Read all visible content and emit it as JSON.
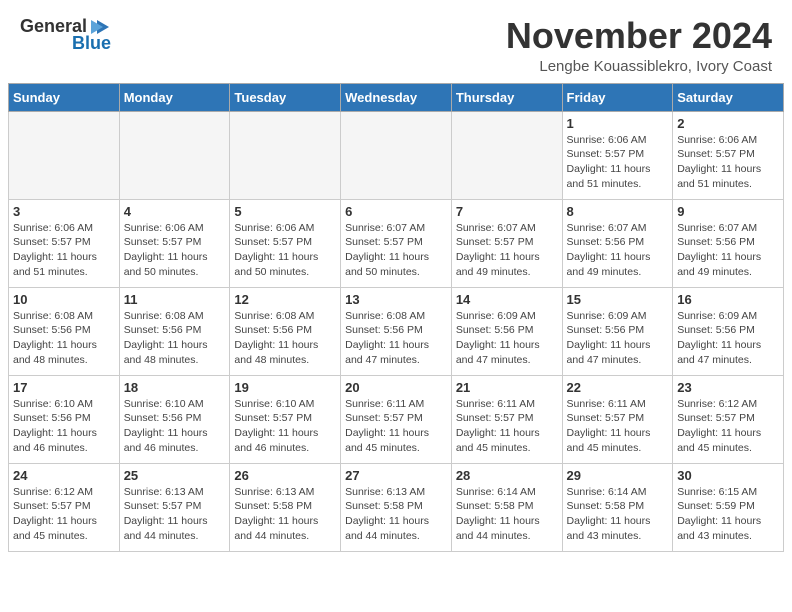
{
  "logo": {
    "general": "General",
    "blue": "Blue"
  },
  "header": {
    "month": "November 2024",
    "location": "Lengbe Kouassiblekro, Ivory Coast"
  },
  "days_of_week": [
    "Sunday",
    "Monday",
    "Tuesday",
    "Wednesday",
    "Thursday",
    "Friday",
    "Saturday"
  ],
  "weeks": [
    [
      {
        "day": "",
        "empty": true
      },
      {
        "day": "",
        "empty": true
      },
      {
        "day": "",
        "empty": true
      },
      {
        "day": "",
        "empty": true
      },
      {
        "day": "",
        "empty": true
      },
      {
        "day": "1",
        "sunrise": "6:06 AM",
        "sunset": "5:57 PM",
        "daylight": "11 hours and 51 minutes."
      },
      {
        "day": "2",
        "sunrise": "6:06 AM",
        "sunset": "5:57 PM",
        "daylight": "11 hours and 51 minutes."
      }
    ],
    [
      {
        "day": "3",
        "sunrise": "6:06 AM",
        "sunset": "5:57 PM",
        "daylight": "11 hours and 51 minutes."
      },
      {
        "day": "4",
        "sunrise": "6:06 AM",
        "sunset": "5:57 PM",
        "daylight": "11 hours and 50 minutes."
      },
      {
        "day": "5",
        "sunrise": "6:06 AM",
        "sunset": "5:57 PM",
        "daylight": "11 hours and 50 minutes."
      },
      {
        "day": "6",
        "sunrise": "6:07 AM",
        "sunset": "5:57 PM",
        "daylight": "11 hours and 50 minutes."
      },
      {
        "day": "7",
        "sunrise": "6:07 AM",
        "sunset": "5:57 PM",
        "daylight": "11 hours and 49 minutes."
      },
      {
        "day": "8",
        "sunrise": "6:07 AM",
        "sunset": "5:56 PM",
        "daylight": "11 hours and 49 minutes."
      },
      {
        "day": "9",
        "sunrise": "6:07 AM",
        "sunset": "5:56 PM",
        "daylight": "11 hours and 49 minutes."
      }
    ],
    [
      {
        "day": "10",
        "sunrise": "6:08 AM",
        "sunset": "5:56 PM",
        "daylight": "11 hours and 48 minutes."
      },
      {
        "day": "11",
        "sunrise": "6:08 AM",
        "sunset": "5:56 PM",
        "daylight": "11 hours and 48 minutes."
      },
      {
        "day": "12",
        "sunrise": "6:08 AM",
        "sunset": "5:56 PM",
        "daylight": "11 hours and 48 minutes."
      },
      {
        "day": "13",
        "sunrise": "6:08 AM",
        "sunset": "5:56 PM",
        "daylight": "11 hours and 47 minutes."
      },
      {
        "day": "14",
        "sunrise": "6:09 AM",
        "sunset": "5:56 PM",
        "daylight": "11 hours and 47 minutes."
      },
      {
        "day": "15",
        "sunrise": "6:09 AM",
        "sunset": "5:56 PM",
        "daylight": "11 hours and 47 minutes."
      },
      {
        "day": "16",
        "sunrise": "6:09 AM",
        "sunset": "5:56 PM",
        "daylight": "11 hours and 47 minutes."
      }
    ],
    [
      {
        "day": "17",
        "sunrise": "6:10 AM",
        "sunset": "5:56 PM",
        "daylight": "11 hours and 46 minutes."
      },
      {
        "day": "18",
        "sunrise": "6:10 AM",
        "sunset": "5:56 PM",
        "daylight": "11 hours and 46 minutes."
      },
      {
        "day": "19",
        "sunrise": "6:10 AM",
        "sunset": "5:57 PM",
        "daylight": "11 hours and 46 minutes."
      },
      {
        "day": "20",
        "sunrise": "6:11 AM",
        "sunset": "5:57 PM",
        "daylight": "11 hours and 45 minutes."
      },
      {
        "day": "21",
        "sunrise": "6:11 AM",
        "sunset": "5:57 PM",
        "daylight": "11 hours and 45 minutes."
      },
      {
        "day": "22",
        "sunrise": "6:11 AM",
        "sunset": "5:57 PM",
        "daylight": "11 hours and 45 minutes."
      },
      {
        "day": "23",
        "sunrise": "6:12 AM",
        "sunset": "5:57 PM",
        "daylight": "11 hours and 45 minutes."
      }
    ],
    [
      {
        "day": "24",
        "sunrise": "6:12 AM",
        "sunset": "5:57 PM",
        "daylight": "11 hours and 45 minutes."
      },
      {
        "day": "25",
        "sunrise": "6:13 AM",
        "sunset": "5:57 PM",
        "daylight": "11 hours and 44 minutes."
      },
      {
        "day": "26",
        "sunrise": "6:13 AM",
        "sunset": "5:58 PM",
        "daylight": "11 hours and 44 minutes."
      },
      {
        "day": "27",
        "sunrise": "6:13 AM",
        "sunset": "5:58 PM",
        "daylight": "11 hours and 44 minutes."
      },
      {
        "day": "28",
        "sunrise": "6:14 AM",
        "sunset": "5:58 PM",
        "daylight": "11 hours and 44 minutes."
      },
      {
        "day": "29",
        "sunrise": "6:14 AM",
        "sunset": "5:58 PM",
        "daylight": "11 hours and 43 minutes."
      },
      {
        "day": "30",
        "sunrise": "6:15 AM",
        "sunset": "5:59 PM",
        "daylight": "11 hours and 43 minutes."
      }
    ]
  ]
}
